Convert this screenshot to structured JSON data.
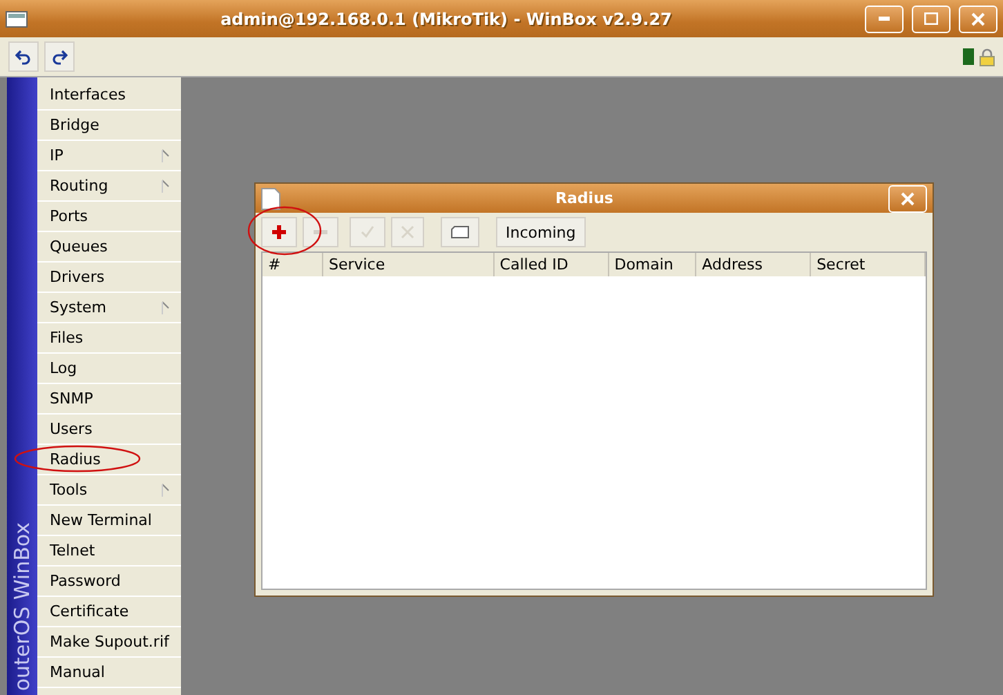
{
  "window": {
    "title": "admin@192.168.0.1 (MikroTik) - WinBox v2.9.27"
  },
  "toolbar": {
    "buttons": [
      {
        "kind": "undo"
      },
      {
        "kind": "redo"
      }
    ],
    "status": {
      "connected": true,
      "secure": true
    }
  },
  "sidebar": {
    "brand": "outerOS WinBox",
    "items": [
      {
        "label": "Interfaces",
        "submenu": false,
        "circled": false
      },
      {
        "label": "Bridge",
        "submenu": false,
        "circled": false
      },
      {
        "label": "IP",
        "submenu": true,
        "circled": false
      },
      {
        "label": "Routing",
        "submenu": true,
        "circled": false
      },
      {
        "label": "Ports",
        "submenu": false,
        "circled": false
      },
      {
        "label": "Queues",
        "submenu": false,
        "circled": false
      },
      {
        "label": "Drivers",
        "submenu": false,
        "circled": false
      },
      {
        "label": "System",
        "submenu": true,
        "circled": false
      },
      {
        "label": "Files",
        "submenu": false,
        "circled": false
      },
      {
        "label": "Log",
        "submenu": false,
        "circled": false
      },
      {
        "label": "SNMP",
        "submenu": false,
        "circled": false
      },
      {
        "label": "Users",
        "submenu": false,
        "circled": false
      },
      {
        "label": "Radius",
        "submenu": false,
        "circled": true
      },
      {
        "label": "Tools",
        "submenu": true,
        "circled": false
      },
      {
        "label": "New Terminal",
        "submenu": false,
        "circled": false
      },
      {
        "label": "Telnet",
        "submenu": false,
        "circled": false
      },
      {
        "label": "Password",
        "submenu": false,
        "circled": false
      },
      {
        "label": "Certificate",
        "submenu": false,
        "circled": false
      },
      {
        "label": "Make Supout.rif",
        "submenu": false,
        "circled": false
      },
      {
        "label": "Manual",
        "submenu": false,
        "circled": false
      }
    ]
  },
  "radius_window": {
    "title": "Radius",
    "toolbar": [
      {
        "kind": "add",
        "disabled": false,
        "circled": true
      },
      {
        "kind": "remove",
        "disabled": true,
        "circled": false
      },
      {
        "kind": "enable",
        "disabled": true,
        "circled": false
      },
      {
        "kind": "disable",
        "disabled": true,
        "circled": false
      },
      {
        "kind": "comment",
        "disabled": false,
        "circled": false
      },
      {
        "kind": "text",
        "label": "Incoming",
        "disabled": false,
        "circled": false
      }
    ],
    "table": {
      "columns": [
        "#",
        "Service",
        "Called ID",
        "Domain",
        "Address",
        "Secret"
      ]
    }
  }
}
